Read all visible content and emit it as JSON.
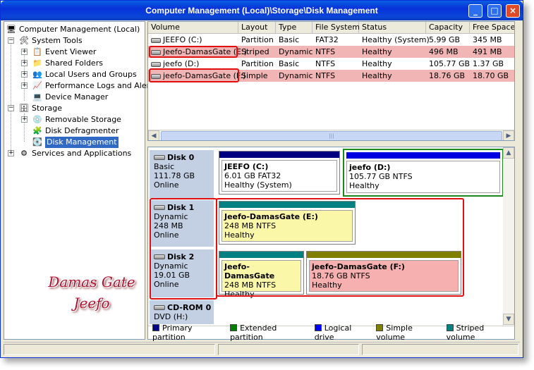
{
  "window": {
    "title": "Computer Management (Local)\\Storage\\Disk Management"
  },
  "tree": {
    "root": "Computer Management (Local)",
    "system_tools": "System Tools",
    "event_viewer": "Event Viewer",
    "shared_folders": "Shared Folders",
    "local_users": "Local Users and Groups",
    "perf_logs": "Performance Logs and Alerts",
    "device_manager": "Device Manager",
    "storage": "Storage",
    "removable": "Removable Storage",
    "defrag": "Disk Defragmenter",
    "disk_mgmt": "Disk Management",
    "services": "Services and Applications"
  },
  "volumes": {
    "columns": [
      "Volume",
      "Layout",
      "Type",
      "File System",
      "Status",
      "Capacity",
      "Free Space"
    ],
    "rows": [
      [
        "JEEFO (C:)",
        "Partition",
        "Basic",
        "FAT32",
        "Healthy (System)",
        "5.99 GB",
        "345 MB"
      ],
      [
        "Jeefo-DamasGate (E:)",
        "Striped",
        "Dynamic",
        "NTFS",
        "Healthy",
        "496 MB",
        "491 MB"
      ],
      [
        "jeefo (D:)",
        "Partition",
        "Basic",
        "NTFS",
        "Healthy",
        "105.77 GB",
        "1.37 GB"
      ],
      [
        "jeefo-DamasGate (F:)",
        "Simple",
        "Dynamic",
        "NTFS",
        "Healthy",
        "18.76 GB",
        "18.70 GB"
      ]
    ]
  },
  "disks": {
    "disk0": {
      "name": "Disk 0",
      "type": "Basic",
      "size": "111.78 GB",
      "status": "Online"
    },
    "disk1": {
      "name": "Disk 1",
      "type": "Dynamic",
      "size": "248 MB",
      "status": "Online"
    },
    "disk2": {
      "name": "Disk 2",
      "type": "Dynamic",
      "size": "19.01 GB",
      "status": "Online"
    },
    "cdrom": {
      "name": "CD-ROM 0",
      "type": "DVD (H:)"
    }
  },
  "partitions": {
    "p_c": {
      "name": "JEEFO  (C:)",
      "size": "6.01 GB FAT32",
      "status": "Healthy (System)"
    },
    "p_d": {
      "name": "jeefo  (D:)",
      "size": "105.77 GB NTFS",
      "status": "Healthy"
    },
    "p_e1": {
      "name": "Jeefo-DamasGate  (E:)",
      "size": "248 MB NTFS",
      "status": "Healthy"
    },
    "p_e2": {
      "name": "Jeefo-DamasGate",
      "size": "248 MB NTFS",
      "status": "Healthy"
    },
    "p_f": {
      "name": "jeefo-DamasGate  (F:)",
      "size": "18.76 GB NTFS",
      "status": "Healthy"
    }
  },
  "legend": {
    "primary": "Primary partition",
    "extended": "Extended partition",
    "logical": "Logical drive",
    "simple": "Simple volume",
    "striped": "Striped volume"
  },
  "colors": {
    "primary": "#000080",
    "extended": "#008000",
    "logical": "#0000ff",
    "simple": "#808000",
    "striped": "#008080",
    "highlight_row": "#f2b5b5",
    "annotation": "#e01010"
  },
  "watermark": {
    "line1": "Damas Gate",
    "line2": "Jeefo"
  }
}
